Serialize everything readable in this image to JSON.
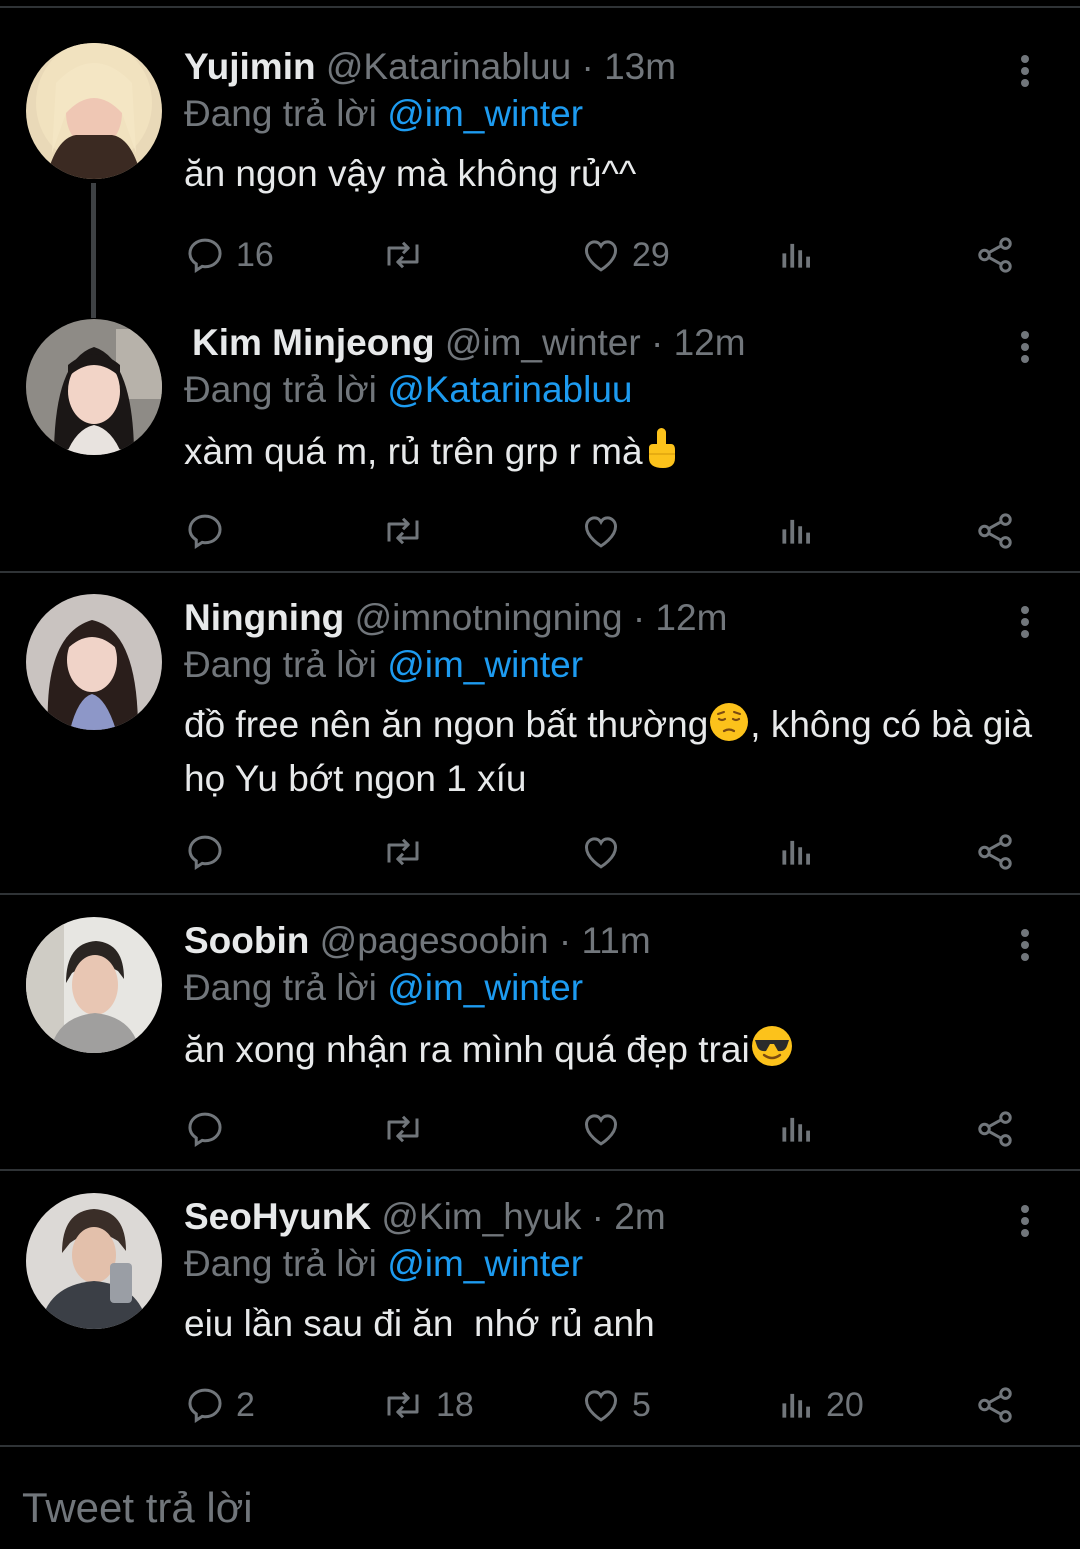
{
  "replying_label": "Đang trả lời",
  "reply_bar": {
    "placeholder": "Tweet trả lời"
  },
  "colors": {
    "background": "#000000",
    "text": "#e7e9ea",
    "muted": "#71767b",
    "link": "#1d9bf0",
    "divider": "#2f3336"
  },
  "tweets": [
    {
      "name": "Yujimin",
      "handle": "@Katarinabluu",
      "time": "13m",
      "reply_to": "@im_winter",
      "text": "ăn ngon vậy mà không rủ^^",
      "replies": "16",
      "retweets": "",
      "likes": "29",
      "views": ""
    },
    {
      "name": "Kim Minjeong",
      "handle": "@im_winter",
      "time": "12m",
      "reply_to": "@Katarinabluu",
      "text": "xàm quá m, rủ trên grp r mà",
      "emoji": "middle-finger-emoji",
      "replies": "",
      "retweets": "",
      "likes": "",
      "views": ""
    },
    {
      "name": "Ningning",
      "handle": "@imnotningning",
      "time": "12m",
      "reply_to": "@im_winter",
      "text_a": "đồ free nên ăn ngon bất thường",
      "text_b": ", không có bà già họ Yu bớt ngon 1 xíu",
      "emoji": "pensive-face-emoji",
      "replies": "",
      "retweets": "",
      "likes": "",
      "views": ""
    },
    {
      "name": "Soobin",
      "handle": "@pagesoobin",
      "time": "11m",
      "reply_to": "@im_winter",
      "text": "ăn xong nhận ra mình quá đẹp trai",
      "emoji": "sunglasses-face-emoji",
      "replies": "",
      "retweets": "",
      "likes": "",
      "views": ""
    },
    {
      "name": "SeoHyunK",
      "handle": "@Kim_hyuk",
      "time": "2m",
      "reply_to": "@im_winter",
      "text": "eiu lần sau đi ăn  nhớ rủ anh",
      "replies": "2",
      "retweets": "18",
      "likes": "5",
      "views": "20"
    }
  ],
  "icons": [
    "reply-icon",
    "retweet-icon",
    "like-icon",
    "views-icon",
    "share-icon",
    "more-icon"
  ]
}
